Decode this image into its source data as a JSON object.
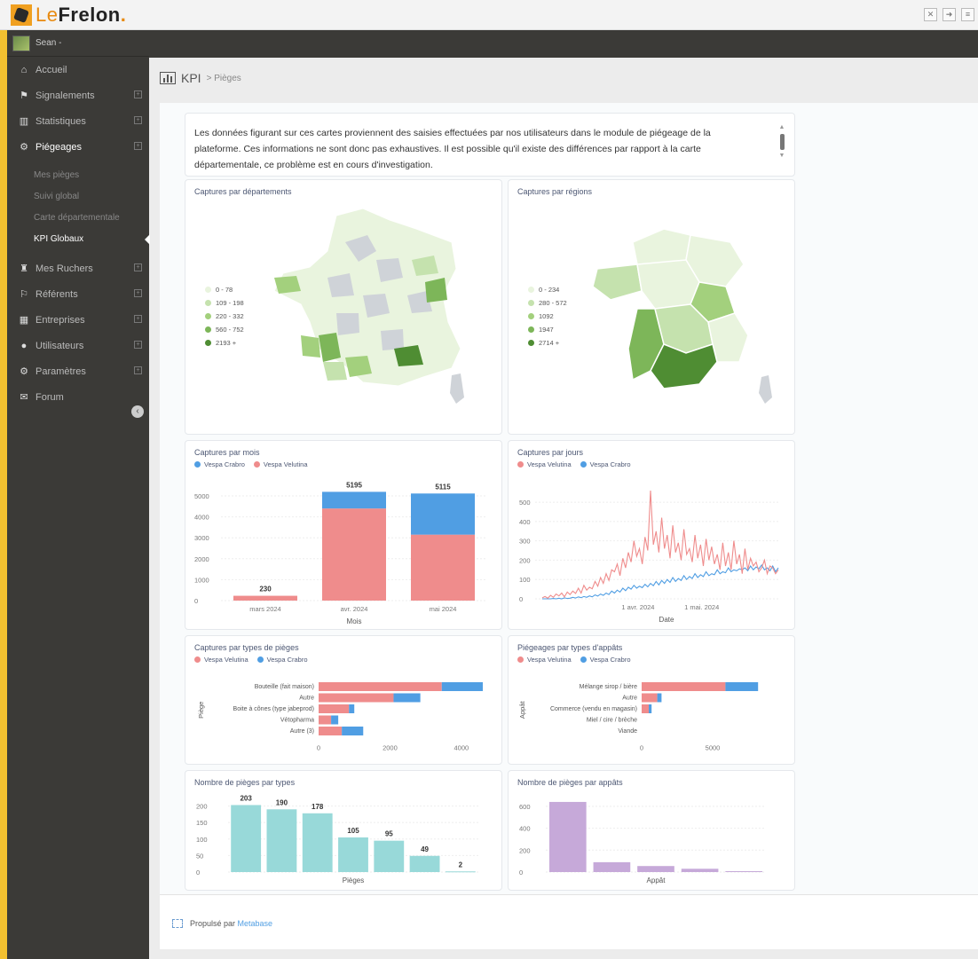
{
  "app": {
    "logo_le": "Le",
    "logo_frelon": "Frelon",
    "logo_dot": "."
  },
  "topbar": {
    "icons": [
      "expand-icon",
      "share-icon",
      "menu-icon"
    ]
  },
  "sidebar": {
    "user": "Sean -",
    "items": [
      {
        "label": "Accueil",
        "icon": "home-icon",
        "glyph": "⌂",
        "expandable": false
      },
      {
        "label": "Signalements",
        "icon": "flag-icon",
        "glyph": "⚑",
        "expandable": true
      },
      {
        "label": "Statistiques",
        "icon": "chart-icon",
        "glyph": "▥",
        "expandable": true
      },
      {
        "label": "Piégeages",
        "icon": "gears-icon",
        "glyph": "⚙",
        "expandable": true
      },
      {
        "label": "Mes Ruchers",
        "icon": "beehive-icon",
        "glyph": "♜",
        "expandable": true
      },
      {
        "label": "Référents",
        "icon": "graduation-icon",
        "glyph": "⚐",
        "expandable": true
      },
      {
        "label": "Entreprises",
        "icon": "building-icon",
        "glyph": "▦",
        "expandable": true
      },
      {
        "label": "Utilisateurs",
        "icon": "user-icon",
        "glyph": "●",
        "expandable": true
      },
      {
        "label": "Paramètres",
        "icon": "settings-icon",
        "glyph": "⚙",
        "expandable": true
      },
      {
        "label": "Forum",
        "icon": "chat-icon",
        "glyph": "✉",
        "expandable": false
      }
    ],
    "subitems": [
      "Mes pièges",
      "Suivi global",
      "Carte départementale",
      "KPI Globaux"
    ],
    "active_sub": "KPI Globaux"
  },
  "breadcrumb": {
    "title": "KPI",
    "sub": "> Pièges"
  },
  "intro": {
    "text": "Les données figurant sur ces cartes proviennent des saisies effectuées par nos utilisateurs dans le module de piégeage de la plateforme. Ces informations ne sont donc pas exhaustives. Il est possible qu'il existe des différences par rapport à la carte départementale, ce problème est en cours d'investigation."
  },
  "colors": {
    "crabro": "#509ee3",
    "velutina": "#ef8c8c",
    "teal": "#98d9d9",
    "purple": "#c6a9d9",
    "map_bins": [
      "#e9f4de",
      "#c5e2ae",
      "#a3d07d",
      "#7db659",
      "#4f8d33"
    ]
  },
  "cards": {
    "dept": {
      "title": "Captures par départements",
      "legend": [
        "0 - 78",
        "109 - 198",
        "220 - 332",
        "560 - 752",
        "2193 +"
      ]
    },
    "regions": {
      "title": "Captures par régions",
      "legend": [
        "0 - 234",
        "280 - 572",
        "1092",
        "1947",
        "2714 +"
      ]
    },
    "mois": {
      "title": "Captures par mois",
      "legend": [
        "Vespa Crabro",
        "Vespa Velutina"
      ]
    },
    "jours": {
      "title": "Captures par jours",
      "legend": [
        "Vespa Velutina",
        "Vespa Crabro"
      ]
    },
    "types": {
      "title": "Captures par types de pièges",
      "legend": [
        "Vespa Velutina",
        "Vespa Crabro"
      ]
    },
    "appats": {
      "title": "Piégeages par types d'appâts",
      "legend": [
        "Vespa Velutina",
        "Vespa Crabro"
      ]
    },
    "nb_types": {
      "title": "Nombre de pièges par types"
    },
    "nb_appats": {
      "title": "Nombre de pièges par appâts"
    }
  },
  "footer": {
    "prefix": "Propulsé par ",
    "link": "Metabase"
  },
  "chart_data": [
    {
      "type": "bar",
      "id": "mois",
      "title": "Captures par mois",
      "categories": [
        "mars 2024",
        "avr. 2024",
        "mai 2024"
      ],
      "series": [
        {
          "name": "Vespa Velutina",
          "values": [
            230,
            4400,
            3150
          ]
        },
        {
          "name": "Vespa Crabro",
          "values": [
            0,
            795,
            1965
          ]
        }
      ],
      "totals": [
        "230",
        "5195",
        "5115"
      ],
      "xlabel": "Mois",
      "ylim": [
        0,
        5000
      ],
      "yticks": [
        "0",
        "1000",
        "2000",
        "3000",
        "4000",
        "5000"
      ]
    },
    {
      "type": "line",
      "id": "jours",
      "title": "Captures par jours",
      "xlabel": "Date",
      "xticks": [
        "1 avr. 2024",
        "1 mai. 2024"
      ],
      "yticks": [
        "0",
        "100",
        "200",
        "300",
        "400",
        "500"
      ],
      "series": [
        {
          "name": "Vespa Velutina",
          "values": [
            5,
            12,
            3,
            18,
            8,
            25,
            15,
            30,
            10,
            35,
            22,
            40,
            28,
            55,
            30,
            70,
            45,
            60,
            52,
            90,
            65,
            110,
            80,
            130,
            95,
            150,
            140,
            180,
            120,
            210,
            160,
            240,
            190,
            300,
            220,
            260,
            180,
            320,
            250,
            560,
            280,
            350,
            240,
            420,
            260,
            330,
            210,
            380,
            240,
            290,
            200,
            360,
            230,
            260,
            190,
            330,
            210,
            280,
            170,
            310,
            200,
            270,
            180,
            230,
            150,
            290,
            170,
            240,
            150,
            300,
            180,
            230,
            130,
            260,
            150,
            210,
            170,
            190,
            140,
            160,
            200,
            130,
            170,
            160,
            130,
            150
          ]
        },
        {
          "name": "Vespa Crabro",
          "values": [
            0,
            0,
            0,
            0,
            2,
            0,
            3,
            0,
            5,
            2,
            3,
            8,
            4,
            10,
            6,
            12,
            8,
            15,
            10,
            20,
            14,
            25,
            18,
            30,
            22,
            40,
            30,
            45,
            35,
            55,
            42,
            60,
            50,
            70,
            55,
            65,
            58,
            75,
            62,
            80,
            68,
            90,
            72,
            95,
            80,
            100,
            85,
            110,
            90,
            105,
            95,
            120,
            100,
            115,
            105,
            130,
            110,
            125,
            115,
            140,
            120,
            130,
            125,
            150,
            130,
            140,
            135,
            160,
            140,
            150,
            145,
            155,
            150,
            160,
            145,
            170,
            150,
            165,
            155,
            175,
            150,
            160,
            145,
            170,
            140,
            160
          ]
        }
      ],
      "ylim": [
        0,
        560
      ]
    },
    {
      "type": "bar",
      "id": "types",
      "orientation": "horizontal",
      "title": "Captures par types de pièges",
      "categories": [
        "Bouteille (fait maison)",
        "Autre",
        "Boite à cônes (type jabeprod)",
        "Vétopharma",
        "Autre (3)"
      ],
      "series": [
        {
          "name": "Vespa Velutina",
          "values": [
            3450,
            2100,
            850,
            350,
            650
          ]
        },
        {
          "name": "Vespa Crabro",
          "values": [
            1150,
            750,
            150,
            200,
            600
          ]
        }
      ],
      "ylabel": "Piège",
      "xticks": [
        "0",
        "2000",
        "4000"
      ],
      "xlim": [
        0,
        4600
      ]
    },
    {
      "type": "bar",
      "id": "appats",
      "orientation": "horizontal",
      "title": "Piégeages par types d'appâts",
      "categories": [
        "Mélange sirop / bière",
        "Autre",
        "Commerce (vendu en magasin)",
        "Miel / cire / brèche",
        "Viande"
      ],
      "series": [
        {
          "name": "Vespa Velutina",
          "values": [
            5900,
            1100,
            500,
            0,
            0
          ]
        },
        {
          "name": "Vespa Crabro",
          "values": [
            2300,
            300,
            200,
            0,
            0
          ]
        }
      ],
      "ylabel": "Appât",
      "xticks": [
        "0",
        "5000"
      ],
      "xlim": [
        0,
        10000
      ]
    },
    {
      "type": "bar",
      "id": "nb_types",
      "title": "Nombre de pièges par types",
      "categories": [
        "",
        "",
        "",
        "",
        "",
        "",
        ""
      ],
      "values": [
        203,
        190,
        178,
        105,
        95,
        49,
        2
      ],
      "labels": [
        "203",
        "190",
        "178",
        "105",
        "95",
        "49",
        "2"
      ],
      "xlabel": "Pièges",
      "ylim": [
        0,
        215
      ],
      "yticks": [
        "0",
        "50",
        "100",
        "150",
        "200"
      ]
    },
    {
      "type": "bar",
      "id": "nb_appats",
      "title": "Nombre de pièges par appâts",
      "categories": [
        "",
        "",
        "",
        "",
        ""
      ],
      "values": [
        640,
        90,
        55,
        30,
        8
      ],
      "xlabel": "Appât",
      "ylim": [
        0,
        680
      ],
      "yticks": [
        "0",
        "200",
        "400",
        "600"
      ]
    }
  ]
}
